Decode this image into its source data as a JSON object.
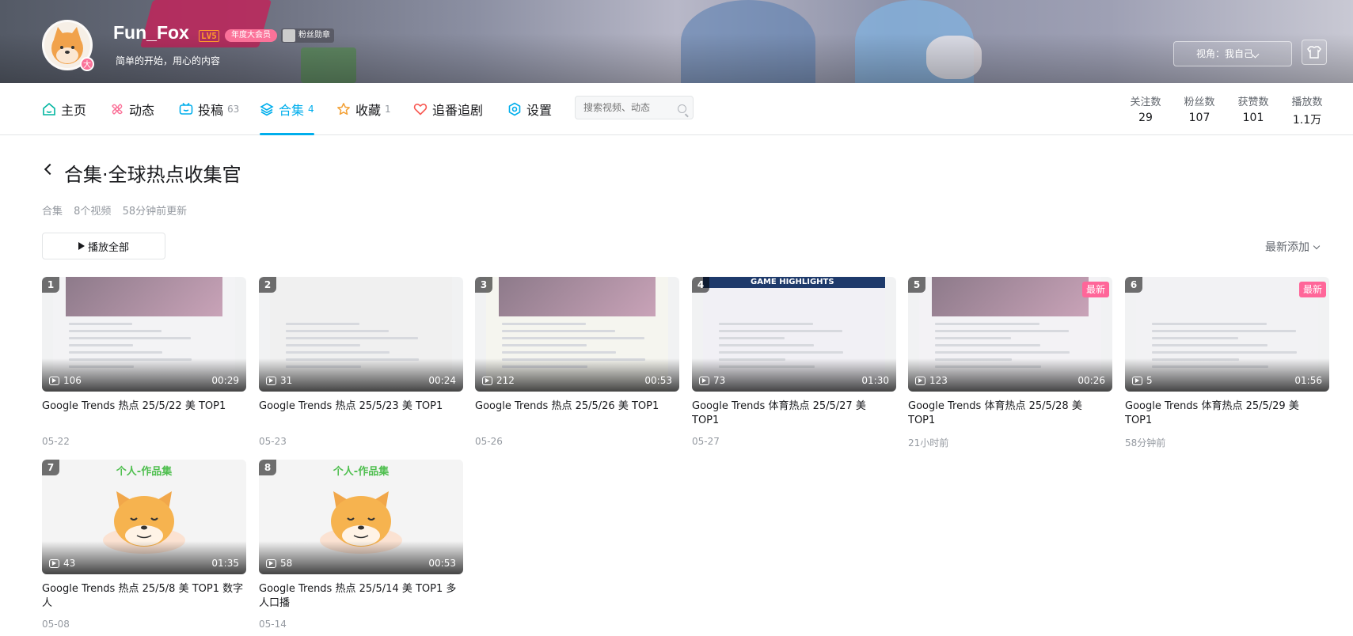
{
  "profile": {
    "name": "Fun_Fox",
    "level": "LV5",
    "vip_label": "年度大会员",
    "fan_medal": "粉丝勋章",
    "avatar_badge": "大",
    "signature": "简单的开始，用心的内容",
    "view_as": "视角：我自己"
  },
  "nav": {
    "items": [
      {
        "label": "主页",
        "count": "",
        "icon": "home-icon",
        "color": "#00aeec"
      },
      {
        "label": "动态",
        "count": "",
        "icon": "dynamic-icon",
        "color": "#fb7299"
      },
      {
        "label": "投稿",
        "count": "63",
        "icon": "tv-icon",
        "color": "#00aeec"
      },
      {
        "label": "合集",
        "count": "4",
        "icon": "layers-icon",
        "color": "#00aeec",
        "active": true
      },
      {
        "label": "收藏",
        "count": "1",
        "icon": "star-icon",
        "color": "#f3a034"
      },
      {
        "label": "追番追剧",
        "count": "",
        "icon": "heart-icon",
        "color": "#f85a54"
      },
      {
        "label": "设置",
        "count": "",
        "icon": "settings-icon",
        "color": "#00aeec"
      }
    ],
    "search_placeholder": "搜索视频、动态"
  },
  "stats": [
    {
      "label": "关注数",
      "value": "29"
    },
    {
      "label": "粉丝数",
      "value": "107"
    },
    {
      "label": "获赞数",
      "value": "101"
    },
    {
      "label": "播放数",
      "value": "1.1万"
    }
  ],
  "collection": {
    "title": "合集·全球热点收集官",
    "type": "合集",
    "video_count": "8个视频",
    "updated": "58分钟前更新",
    "play_all": "播放全部",
    "sort": "最新添加"
  },
  "videos": [
    {
      "index": "1",
      "plays": "106",
      "duration": "00:29",
      "title": "Google Trends 热点 25/5/22 美 TOP1",
      "date": "05-22",
      "new": ""
    },
    {
      "index": "2",
      "plays": "31",
      "duration": "00:24",
      "title": "Google Trends 热点 25/5/23 美 TOP1",
      "date": "05-23",
      "new": ""
    },
    {
      "index": "3",
      "plays": "212",
      "duration": "00:53",
      "title": "Google Trends 热点 25/5/26 美 TOP1",
      "date": "05-26",
      "new": ""
    },
    {
      "index": "4",
      "plays": "73",
      "duration": "01:30",
      "title": "Google Trends 体育热点 25/5/27 美 TOP1",
      "date": "05-27",
      "new": "",
      "thumb_header": "GAME HIGHLIGHTS"
    },
    {
      "index": "5",
      "plays": "123",
      "duration": "00:26",
      "title": "Google Trends 体育热点 25/5/28 美 TOP1",
      "date": "21小时前",
      "new": "最新"
    },
    {
      "index": "6",
      "plays": "5",
      "duration": "01:56",
      "title": "Google Trends 体育热点 25/5/29 美 TOP1",
      "date": "58分钟前",
      "new": "最新"
    },
    {
      "index": "7",
      "plays": "43",
      "duration": "01:35",
      "title": "Google Trends 热点 25/5/8 美 TOP1 数字人",
      "date": "05-08",
      "new": "",
      "thumb_caption": "个人-作品集"
    },
    {
      "index": "8",
      "plays": "58",
      "duration": "00:53",
      "title": "Google Trends 热点 25/5/14 美 TOP1 多人口播",
      "date": "05-14",
      "new": "",
      "thumb_caption": "个人-作品集"
    }
  ]
}
